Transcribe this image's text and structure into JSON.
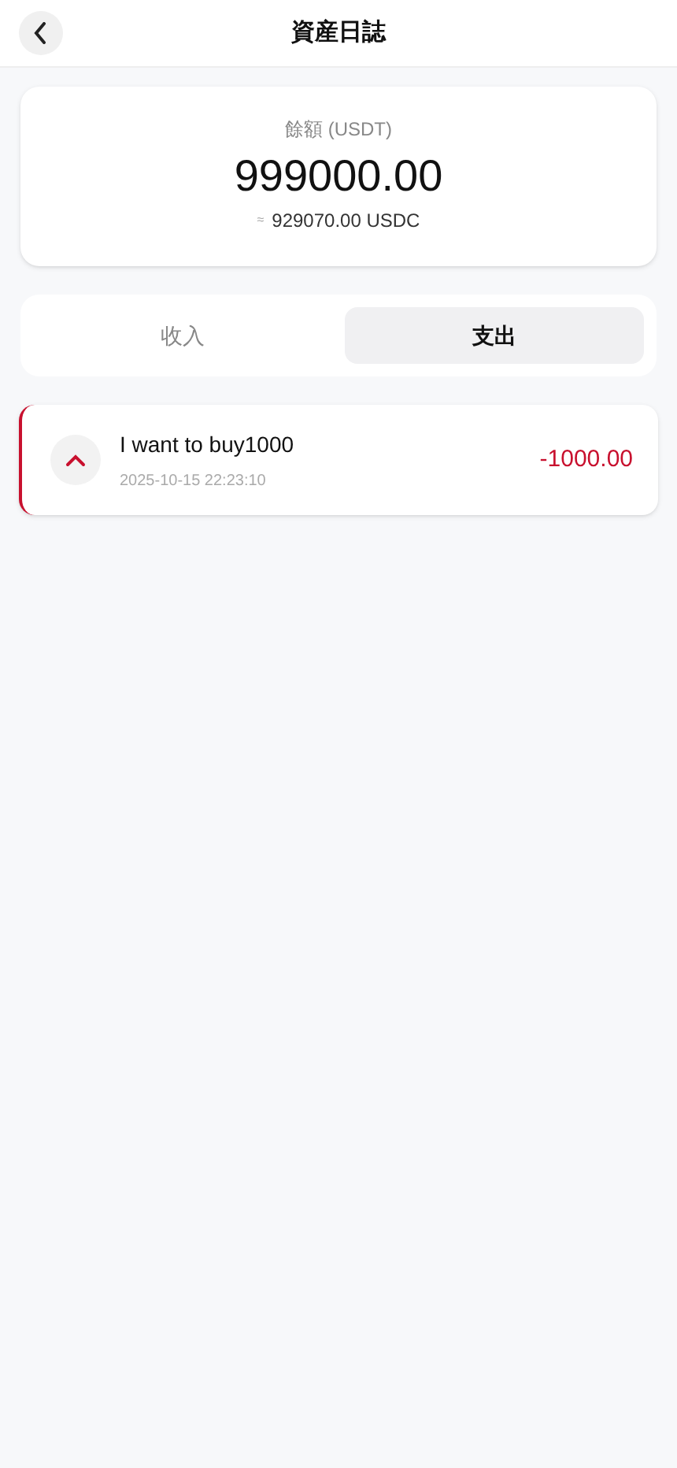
{
  "header": {
    "title": "資産日誌"
  },
  "balance": {
    "label": "餘額 (USDT)",
    "amount": "999000.00",
    "approx_sign": "≈",
    "converted": "929070.00 USDC"
  },
  "tabs": [
    {
      "label": "收入",
      "selected": false
    },
    {
      "label": "支出",
      "selected": true
    }
  ],
  "transactions": [
    {
      "kind": "expense",
      "title": "I want to buy1000",
      "time": "2025-10-15 22:23:10",
      "amount": "-1000.00"
    }
  ]
}
